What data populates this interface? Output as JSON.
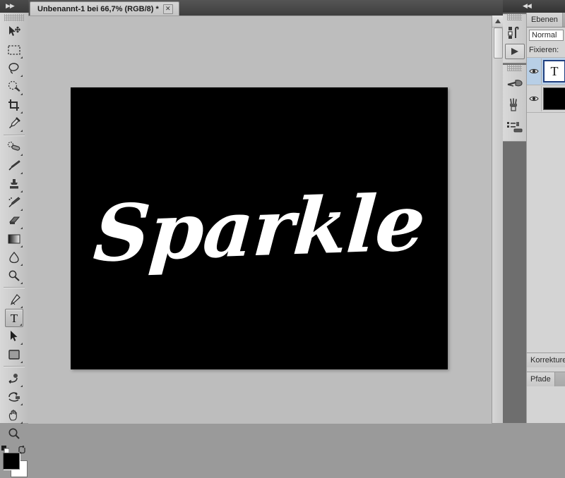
{
  "window": {
    "collapse_left_icon": "double-chevron-right-icon",
    "collapse_right_icon": "double-chevron-left-icon",
    "collapse_left_glyph": "▶▶",
    "collapse_right_glyph": "◀◀"
  },
  "document_tab": {
    "title": "Unbenannt-1 bei 66,7% (RGB/8) *",
    "close_glyph": "✕",
    "zoom_level": "66,7%",
    "color_mode": "RGB/8",
    "modified": true
  },
  "canvas": {
    "text": "Sparkle",
    "text_color": "#ffffff",
    "background_color": "#000000",
    "workspace_color": "#bdbdbd"
  },
  "toolbox": {
    "active_tool": "type-tool",
    "tools": [
      {
        "name": "move-tool",
        "label": "Verschieben"
      },
      {
        "name": "rectangular-marquee-tool",
        "label": "Auswahlrechteck"
      },
      {
        "name": "lasso-tool",
        "label": "Lasso"
      },
      {
        "name": "quick-selection-tool",
        "label": "Schnellauswahl"
      },
      {
        "name": "crop-tool",
        "label": "Freistellen"
      },
      {
        "name": "eyedropper-tool",
        "label": "Pipette"
      },
      {
        "name": "healing-brush-tool",
        "label": "Reparatur-Pinsel"
      },
      {
        "name": "brush-tool",
        "label": "Pinsel"
      },
      {
        "name": "clone-stamp-tool",
        "label": "Kopierstempel"
      },
      {
        "name": "history-brush-tool",
        "label": "Protokollpinsel"
      },
      {
        "name": "eraser-tool",
        "label": "Radiergummi"
      },
      {
        "name": "gradient-tool",
        "label": "Verlauf"
      },
      {
        "name": "blur-tool",
        "label": "Weichzeichner"
      },
      {
        "name": "dodge-tool",
        "label": "Abwedler"
      },
      {
        "name": "pen-tool",
        "label": "Zeichenstift"
      },
      {
        "name": "type-tool",
        "label": "Text"
      },
      {
        "name": "path-selection-tool",
        "label": "Pfadauswahl"
      },
      {
        "name": "shape-tool",
        "label": "Form"
      },
      {
        "name": "rotate-3d-tool",
        "label": "3D-Objekt drehen"
      },
      {
        "name": "orbit-3d-camera-tool",
        "label": "3D-Kamera"
      },
      {
        "name": "hand-tool",
        "label": "Hand"
      },
      {
        "name": "zoom-tool",
        "label": "Zoom"
      }
    ],
    "type_tool_glyph": "T",
    "colors": {
      "foreground": "#000000",
      "background": "#ffffff",
      "default_icon": "default-colors-icon",
      "swap_icon": "swap-colors-icon"
    }
  },
  "dock": {
    "items": [
      {
        "name": "history-icon",
        "label": "Protokoll"
      },
      {
        "name": "actions-play-icon",
        "label": "Aktionen"
      },
      {
        "name": "brush-presets-icon",
        "label": "Pinselvorgaben"
      },
      {
        "name": "brush-panel-icon",
        "label": "Pinsel"
      },
      {
        "name": "tool-presets-icon",
        "label": "Werkzeugvorgaben"
      }
    ]
  },
  "layers_panel": {
    "tab_label": "Ebenen",
    "blend_mode": "Normal",
    "lock_label": "Fixieren:",
    "layers": [
      {
        "name": "text-layer",
        "thumb": "T",
        "visible": true,
        "selected": true,
        "type": "type"
      },
      {
        "name": "background-layer",
        "thumb": "",
        "visible": true,
        "selected": false,
        "type": "raster"
      }
    ],
    "eye_glyph": "◉"
  },
  "bottom_panels": {
    "adjustments_tab": "Korrekturen",
    "paths_tab": "Pfade"
  },
  "scrollbar": {
    "up_arrow_glyph": "▲"
  }
}
